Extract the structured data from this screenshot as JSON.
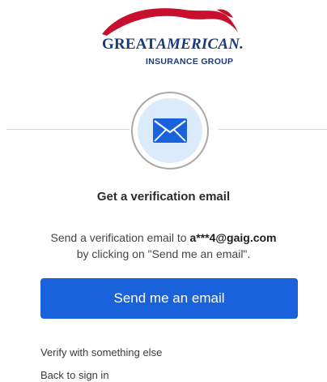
{
  "logo": {
    "word_part1": "GREAT",
    "word_part2": "AMERICAN.",
    "subtitle": "INSURANCE GROUP",
    "swoosh_color": "#c8102e",
    "brand_color": "#1b3a7a"
  },
  "icon": {
    "name": "envelope-icon",
    "color": "#1a62db",
    "bg": "#dcebfa"
  },
  "content": {
    "title": "Get a verification email",
    "desc_prefix": "Send a verification email to ",
    "email": "a***4@gaig.com",
    "desc_suffix": "by clicking on \"Send me an email\"."
  },
  "actions": {
    "send_label": "Send me an email",
    "verify_other_label": "Verify with something else",
    "back_label": "Back to sign in"
  },
  "colors": {
    "primary": "#1a62db"
  }
}
